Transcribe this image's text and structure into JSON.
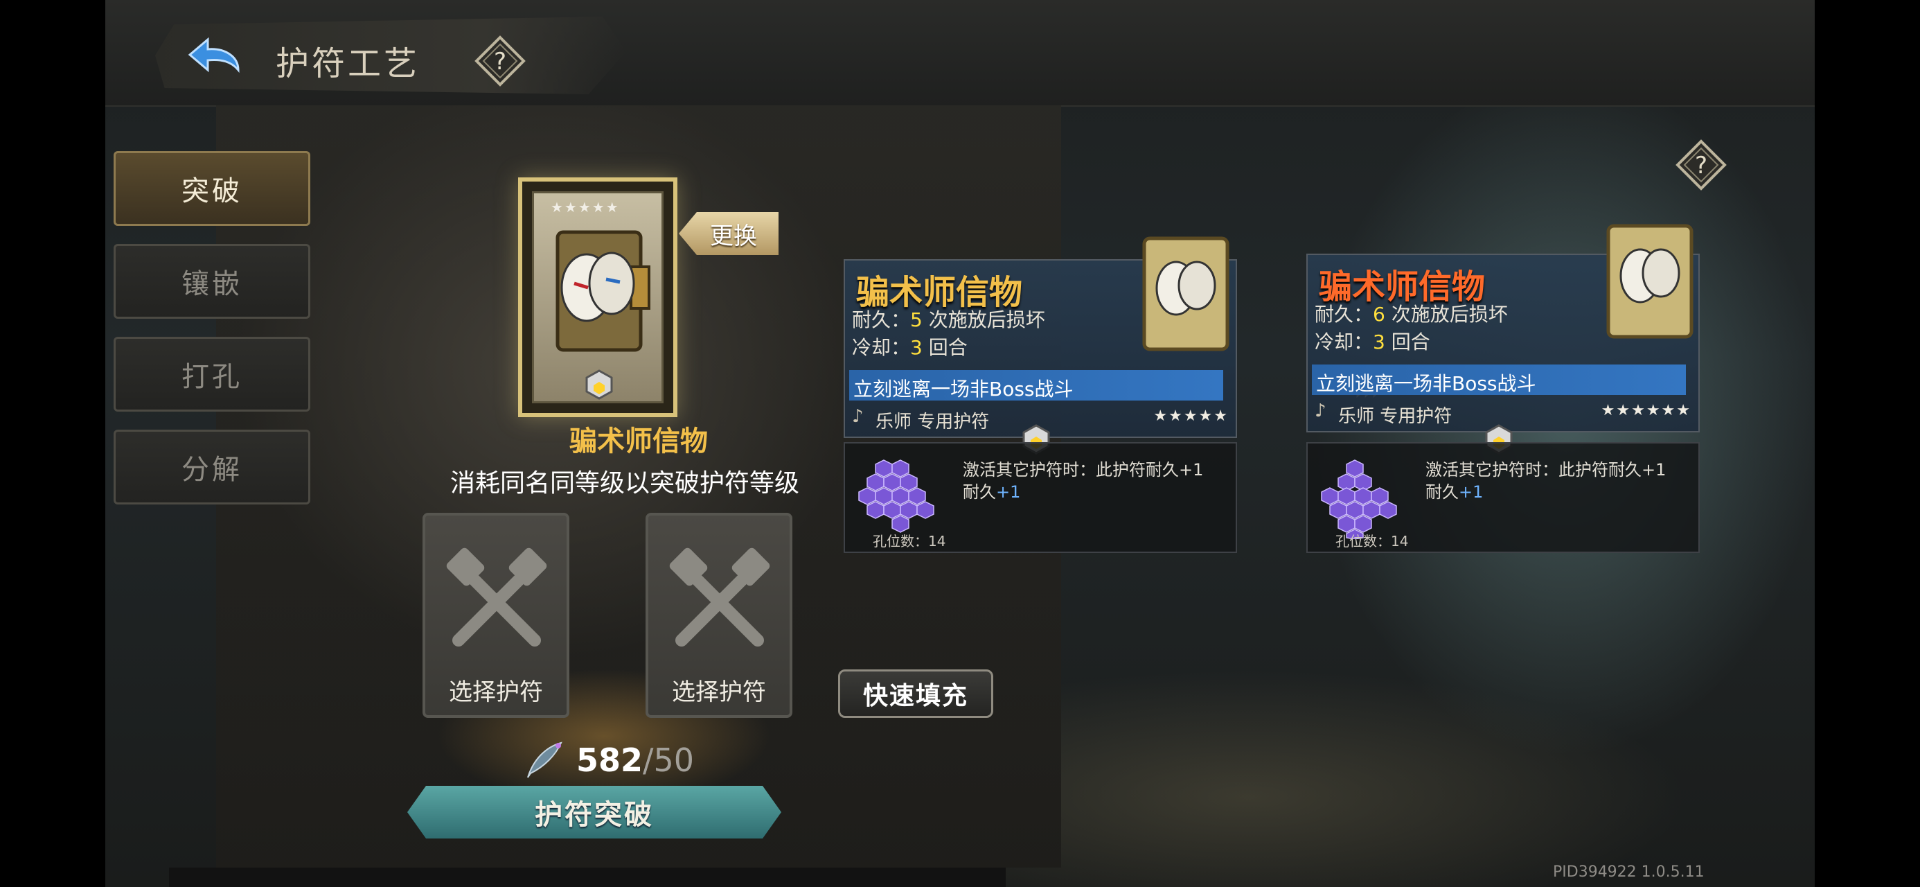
{
  "header": {
    "title": "护符工艺",
    "back_icon": "back-arrow-icon",
    "help_icon": "question-diamond-icon"
  },
  "sidebar": {
    "tabs": [
      {
        "label": "突破",
        "active": true
      },
      {
        "label": "镶嵌",
        "active": false
      },
      {
        "label": "打孔",
        "active": false
      },
      {
        "label": "分解",
        "active": false
      }
    ]
  },
  "selected_card": {
    "name": "骗术师信物",
    "change_label": "更换",
    "stars": "★★★★★"
  },
  "instruction": "消耗同名同等级以突破护符等级",
  "slots": [
    {
      "label": "选择护符"
    },
    {
      "label": "选择护符"
    }
  ],
  "quick_fill_label": "快速填充",
  "resource": {
    "current": "582",
    "required": "/50"
  },
  "break_button_label": "护符突破",
  "current_info": {
    "name": "骗术师信物",
    "durability_prefix": "耐久：",
    "durability_value": "5",
    "durability_suffix": " 次施放后损坏",
    "cooldown_prefix": "冷却：",
    "cooldown_value": "3",
    "cooldown_suffix": " 回合",
    "effect": "立刻逃离一场非Boss战斗",
    "class_label": "乐师 专用护符",
    "stars": "★★★★★",
    "socket_desc": "激活其它护符时：此护符耐久+1",
    "socket_bonus_prefix": "耐久",
    "socket_bonus_value": "+1",
    "socket_count": "孔位数：14"
  },
  "next_info": {
    "name": "骗术师信物",
    "durability_prefix": "耐久：",
    "durability_value": "6",
    "durability_suffix": " 次施放后损坏",
    "cooldown_prefix": "冷却：",
    "cooldown_value": "3",
    "cooldown_suffix": " 回合",
    "effect": "立刻逃离一场非Boss战斗",
    "class_label": "乐师 专用护符",
    "stars": "★★★★★★",
    "socket_desc": "激活其它护符时：此护符耐久+1",
    "socket_bonus_prefix": "耐久",
    "socket_bonus_value": "+1",
    "socket_count": "孔位数：14"
  },
  "footer": {
    "pid": "PID394922  1.0.5.11"
  },
  "colors": {
    "current_name": "#f3c04a",
    "next_name": "#ff6a2a",
    "highlight_number": "#ffdf3d",
    "bonus": "#6fb4ff"
  }
}
